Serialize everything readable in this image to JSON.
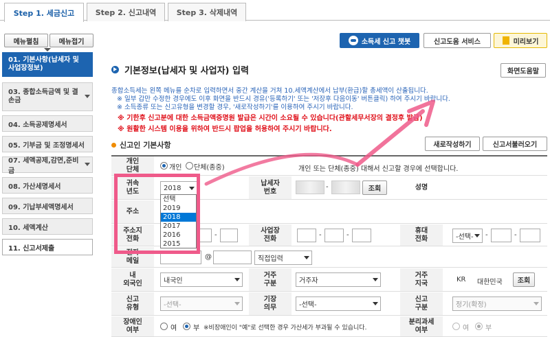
{
  "tabs": [
    "Step 1. 세금신고",
    "Step 2. 신고내역",
    "Step 3. 삭제내역"
  ],
  "sidebar": {
    "expand_label": "메뉴펼침",
    "collapse_label": "메뉴접기",
    "items": [
      {
        "label": "01. 기본사항(납세자 및 사업장정보)"
      },
      {
        "label": "03. 종합소득금액 및 결손금"
      },
      {
        "label": "04. 소득공제명세서"
      },
      {
        "label": "05. 기부금 및 조정명세서"
      },
      {
        "label": "07. 세액공제,감면,준비금"
      },
      {
        "label": "08. 가산세명세서"
      },
      {
        "label": "09. 기납부세액명세서"
      },
      {
        "label": "10. 세액계산"
      },
      {
        "label": "11. 신고서제출"
      }
    ]
  },
  "toolbar": {
    "chatbot_label": "소득세 신고 챗봇",
    "help_service_label": "신고도움 서비스",
    "preview_label": "미리보기"
  },
  "main": {
    "title": "기본정보(납세자 및 사업자) 입력",
    "screen_help_label": "화면도움말",
    "notices": [
      "종합소득세는 왼쪽 메뉴를 순차로 입력하면서 중간 계산을 거쳐 10.세액계산에서 납부(환급)할 총세액이 산출됩니다.",
      "※ 일부 갑만 수정한 경우에도 이후 화면을 반드시 경유('등록하기' 또는 '저장후 다음이동' 버튼클릭) 하여 주시기 바랍니다.",
      "※ 소득종류 또는 신고유형을 변경할 경우, '새로작성하기'를 이용하여 주시기 바랍니다."
    ],
    "warnings": [
      "※ 기한후 신고분에 대한 소득금액증명원 발급은 시간이 소요될 수 있습니다(관할세무서장의 결정후 발급)",
      "※ 원활한 시스템 이용을 위하여 반드시 팝업을 허용하여 주시기 바랍니다."
    ]
  },
  "section": {
    "title": "신고인 기본사항",
    "new_label": "새로작성하기",
    "load_label": "신고서불러오기"
  },
  "form": {
    "type_label": "개인\n단체",
    "type_personal": "개인",
    "type_group": "단체(종중)",
    "type_note": "개인 또는 단체(종중) 대해서 신고할 경우에 선택합니다.",
    "year_label": "귀속\n년도",
    "year_value": "2018",
    "year_options": [
      "선택",
      "2019",
      "2018",
      "2017",
      "2016",
      "2015"
    ],
    "taxpayer_no_label": "납세자\n번호",
    "lookup_label": "조회",
    "name_label": "성명",
    "address_label": "주소",
    "home_phone_label": "주소지\n전화",
    "biz_phone_label": "사업장\n전화",
    "mobile_label": "휴대\n전화",
    "mobile_prefix": "-선택-",
    "email_label": "전자\n메일",
    "email_domain": "직접입력",
    "residency_label": "내\n외국인",
    "residency_value": "내국인",
    "resident_label": "거주\n구분",
    "resident_value": "거주자",
    "country_label": "거주\n지국",
    "country_code": "KR",
    "country_name": "대한민국",
    "country_lookup": "조회",
    "filing_type_label": "신고\n유형",
    "filing_type_value": "-선택-",
    "bookkeeping_label": "기장\n의무",
    "bookkeeping_value": "-선택-",
    "filing_class_label": "신고\n구분",
    "filing_class_value": "정기(확정)",
    "disabled_label": "장애인\n여부",
    "yes": "여",
    "no": "부",
    "disabled_note": "※비장애인이 \"예\"로 선택한 경우 가산세가 부과될 수 있습니다.",
    "separate_tax_label": "분리과세\n여부",
    "dash": "-",
    "at": "@"
  },
  "annotation_color": "#ef5a8a"
}
